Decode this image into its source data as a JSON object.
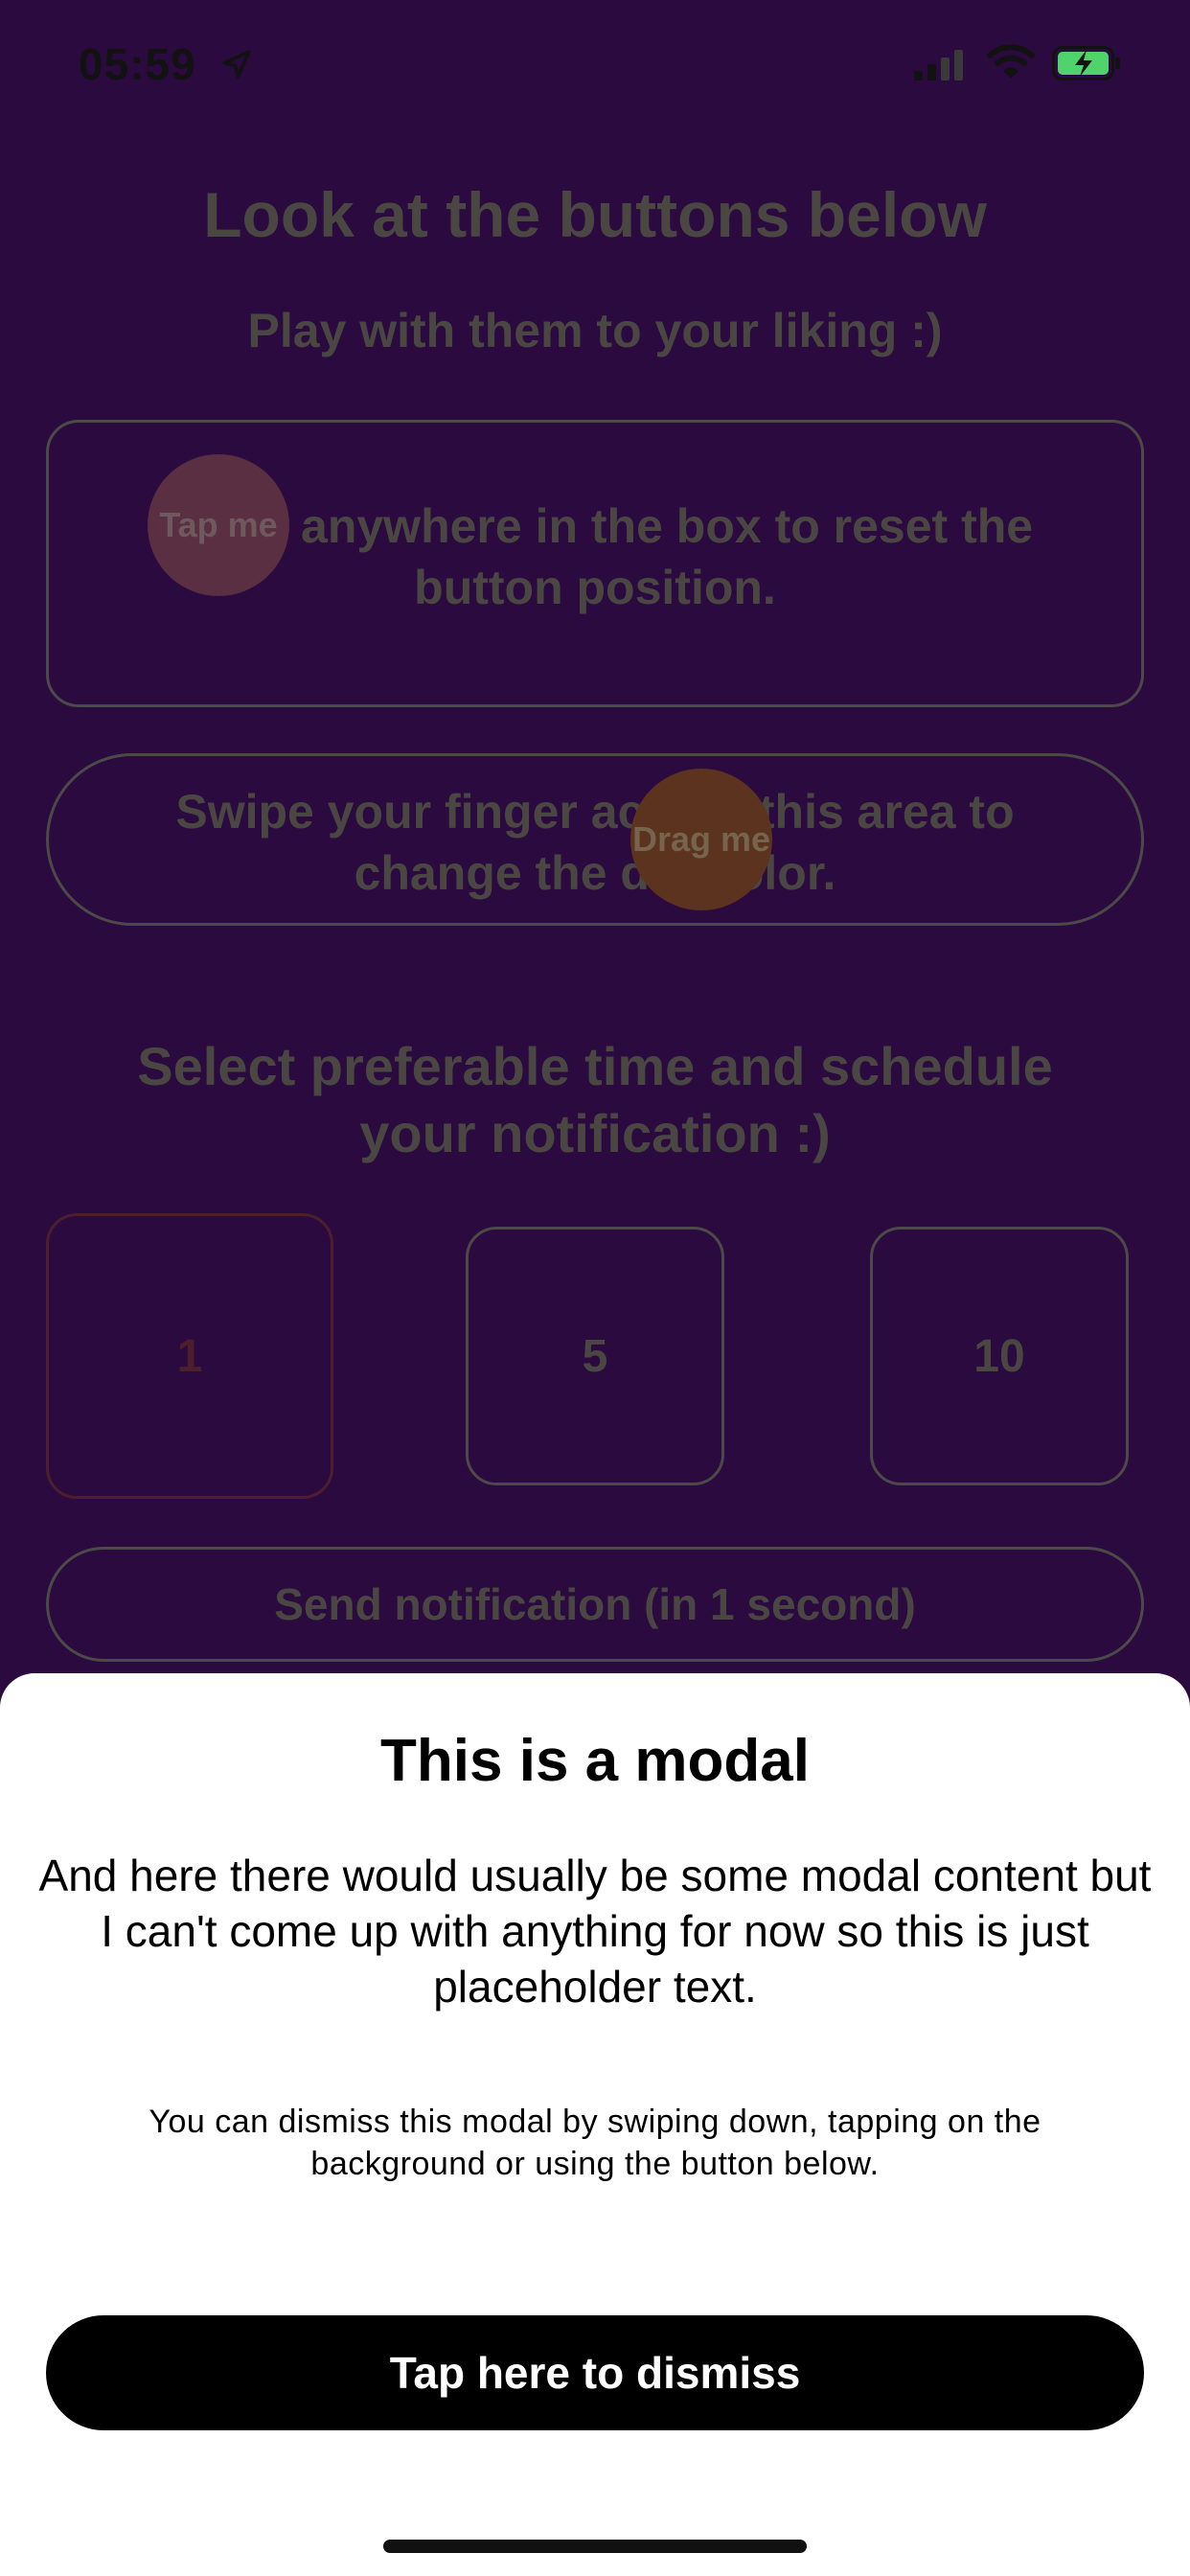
{
  "status_bar": {
    "time": "05:59",
    "icons": [
      "location-arrow-icon",
      "cellular-signal-icon",
      "wifi-icon",
      "battery-charging-icon"
    ]
  },
  "screen": {
    "heading": "Look at the buttons below",
    "subheading": "Play with them to your liking :)",
    "tap_box_text": "Press anywhere in the box to reset the button position.",
    "tap_button_label": "Tap me",
    "swipe_box_text": "Swipe your finger across this area to change the dot color.",
    "drag_button_label": "Drag me",
    "select_heading": "Select preferable time and schedule your notification :)",
    "time_options": [
      "1",
      "5",
      "10"
    ],
    "selected_time": "1",
    "send_button_label": "Send notification (in 1 second)"
  },
  "modal": {
    "title": "This is a modal",
    "body": "And here there would usually be some modal content but I can't come up with anything for now so this is just placeholder text.",
    "hint": "You can dismiss this modal by swiping down, tapping on the background or using the button below.",
    "dismiss_label": "Tap here to dismiss"
  },
  "colors": {
    "background": "#2b0a3f",
    "modal": "#ffffff",
    "dismiss_button": "#000000",
    "selected_option_border": "#4d1f2d"
  }
}
